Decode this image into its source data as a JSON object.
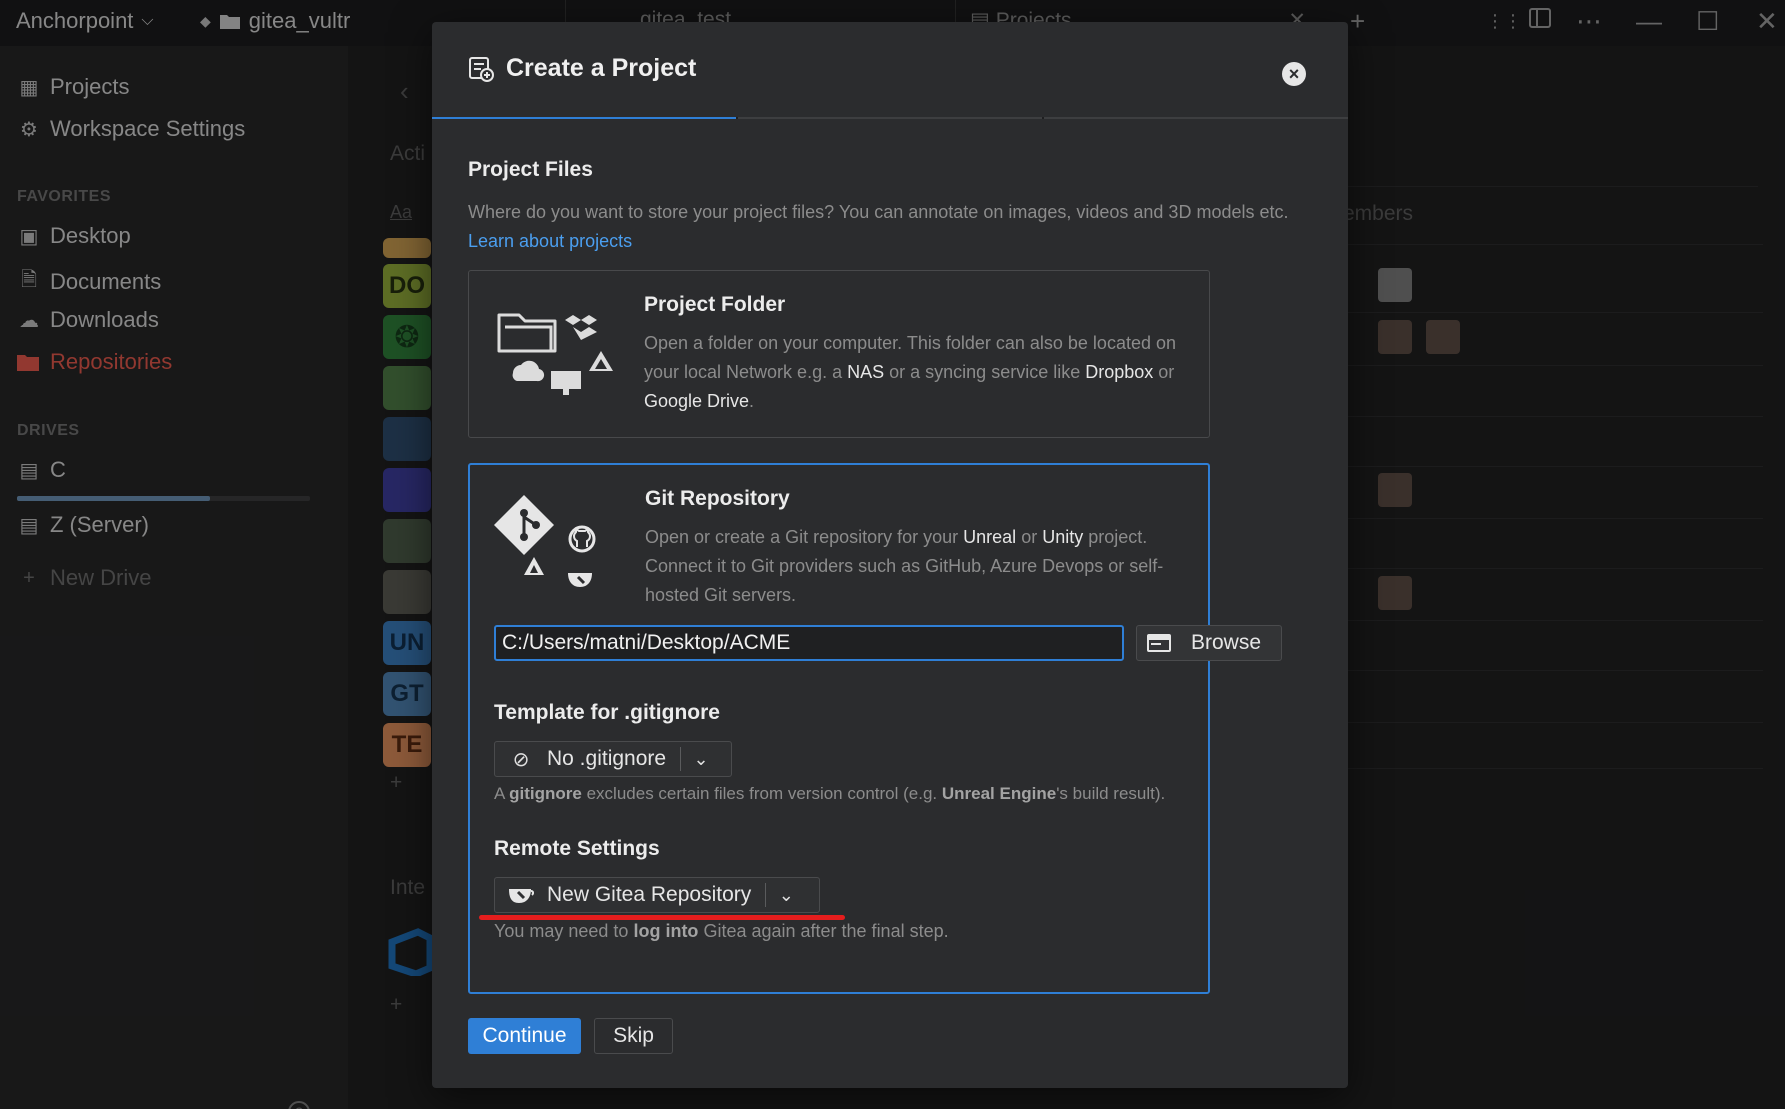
{
  "titlebar": {
    "workspace": "Anchorpoint",
    "breadcrumb": "gitea_vultr",
    "tabs": [
      "gitea_test",
      "Projects"
    ]
  },
  "sidebar": {
    "projects": "Projects",
    "workspace_settings": "Workspace Settings",
    "favorites_heading": "FAVORITES",
    "favorites": [
      "Desktop",
      "Documents",
      "Downloads",
      "Repositories"
    ],
    "drives_heading": "DRIVES",
    "drives": [
      "C",
      "Z (Server)"
    ],
    "drive_c_usage": 0.66,
    "new_drive": "New Drive"
  },
  "background": {
    "section_active": "Acti",
    "section_integrations": "Inte",
    "members_header": "embers",
    "filter_label": "Aa",
    "project_thumbs": [
      "DO",
      "UN",
      "GT",
      "TE"
    ]
  },
  "modal": {
    "title": "Create a Project",
    "section_heading": "Project Files",
    "section_desc": "Where do you want to store your project files? You can annotate on images, videos and 3D models etc.",
    "learn_link": "Learn about projects",
    "folder_card": {
      "title": "Project Folder",
      "desc_1": "Open a folder on your computer. This folder can also be located on your local Network e.g. a",
      "nas": "NAS",
      "desc_2": "or a syncing service like",
      "dropbox": "Dropbox",
      "or": "or",
      "gdrive": "Google Drive",
      "period": "."
    },
    "git_card": {
      "title": "Git Repository",
      "desc_1": "Open or create a Git repository for your",
      "unreal": "Unreal",
      "or": "or",
      "unity": "Unity",
      "desc_2": "project. Connect it to Git providers such as GitHub, Azure Devops or self-hosted Git servers.",
      "path_value": "C:/Users/matni/Desktop/ACME",
      "browse_label": "Browse",
      "gitignore_heading": "Template for .gitignore",
      "gitignore_value": "No .gitignore",
      "gitignore_note_a": "A",
      "gitignore_note_word": "gitignore",
      "gitignore_note_b": "excludes certain files from version control (e.g.",
      "gitignore_note_engine": "Unreal Engine",
      "gitignore_note_c": "'s build result).",
      "remote_heading": "Remote Settings",
      "remote_value": "New Gitea Repository",
      "remote_note_a": "You may need to",
      "remote_note_bold": "log into",
      "remote_note_b": "Gitea again after the final step."
    },
    "continue_label": "Continue",
    "skip_label": "Skip"
  },
  "colors": {
    "accent": "#2f7fd6",
    "highlight_underline": "#e51d1d",
    "active_sidebar": "#e0574a"
  }
}
